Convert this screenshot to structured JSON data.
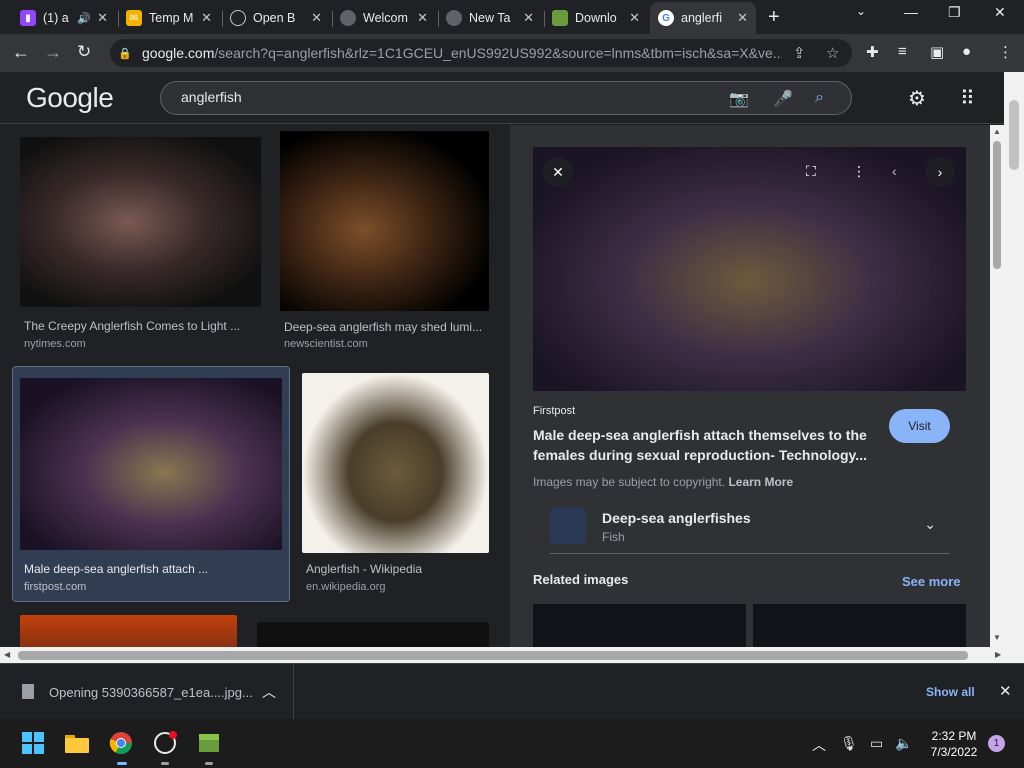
{
  "browser": {
    "tabs": [
      {
        "title": "(1) a",
        "favicon": "twitch-icon",
        "color": "#9146ff"
      },
      {
        "title": "Temp M",
        "favicon": "mail-icon",
        "color": "#f2b400"
      },
      {
        "title": "Open B",
        "favicon": "openai-icon",
        "color": "#5f6368"
      },
      {
        "title": "Welcom",
        "favicon": "globe-icon",
        "color": "#5f6368"
      },
      {
        "title": "New Ta",
        "favicon": "chrome-icon",
        "color": "#5f6368"
      },
      {
        "title": "Downlo",
        "favicon": "download-site-icon",
        "color": "#6a9b3c"
      },
      {
        "title": "anglerfi",
        "favicon": "google-icon",
        "color": "#4285f4"
      }
    ],
    "url_host": "google.com",
    "url_rest": "/search?q=anglerfish&rlz=1C1GCEU_enUS992US992&source=lnms&tbm=isch&sa=X&ve..."
  },
  "google": {
    "logo": "Google",
    "query": "anglerfish"
  },
  "results": [
    {
      "caption": "The Creepy Anglerfish Comes to Light ...",
      "site": "nytimes.com"
    },
    {
      "caption": "Deep-sea anglerfish may shed lumi...",
      "site": "newscientist.com"
    },
    {
      "caption": "Male deep-sea anglerfish attach ...",
      "site": "firstpost.com"
    },
    {
      "caption": "Anglerfish - Wikipedia",
      "site": "en.wikipedia.org"
    }
  ],
  "panel": {
    "source": "Firstpost",
    "title": "Male deep-sea anglerfish attach themselves to the females during sexual reproduction- Technology...",
    "visit_label": "Visit",
    "copyright_text": "Images may be subject to copyright.",
    "learn_more": "Learn More",
    "kg_title": "Deep-sea anglerfishes",
    "kg_subtitle": "Fish",
    "related_label": "Related images",
    "see_more": "See more"
  },
  "download": {
    "filename": "Opening 5390366587_e1ea....jpg...",
    "show_all": "Show all"
  },
  "taskbar": {
    "time": "2:32 PM",
    "date": "7/3/2022",
    "notifications": "1"
  }
}
